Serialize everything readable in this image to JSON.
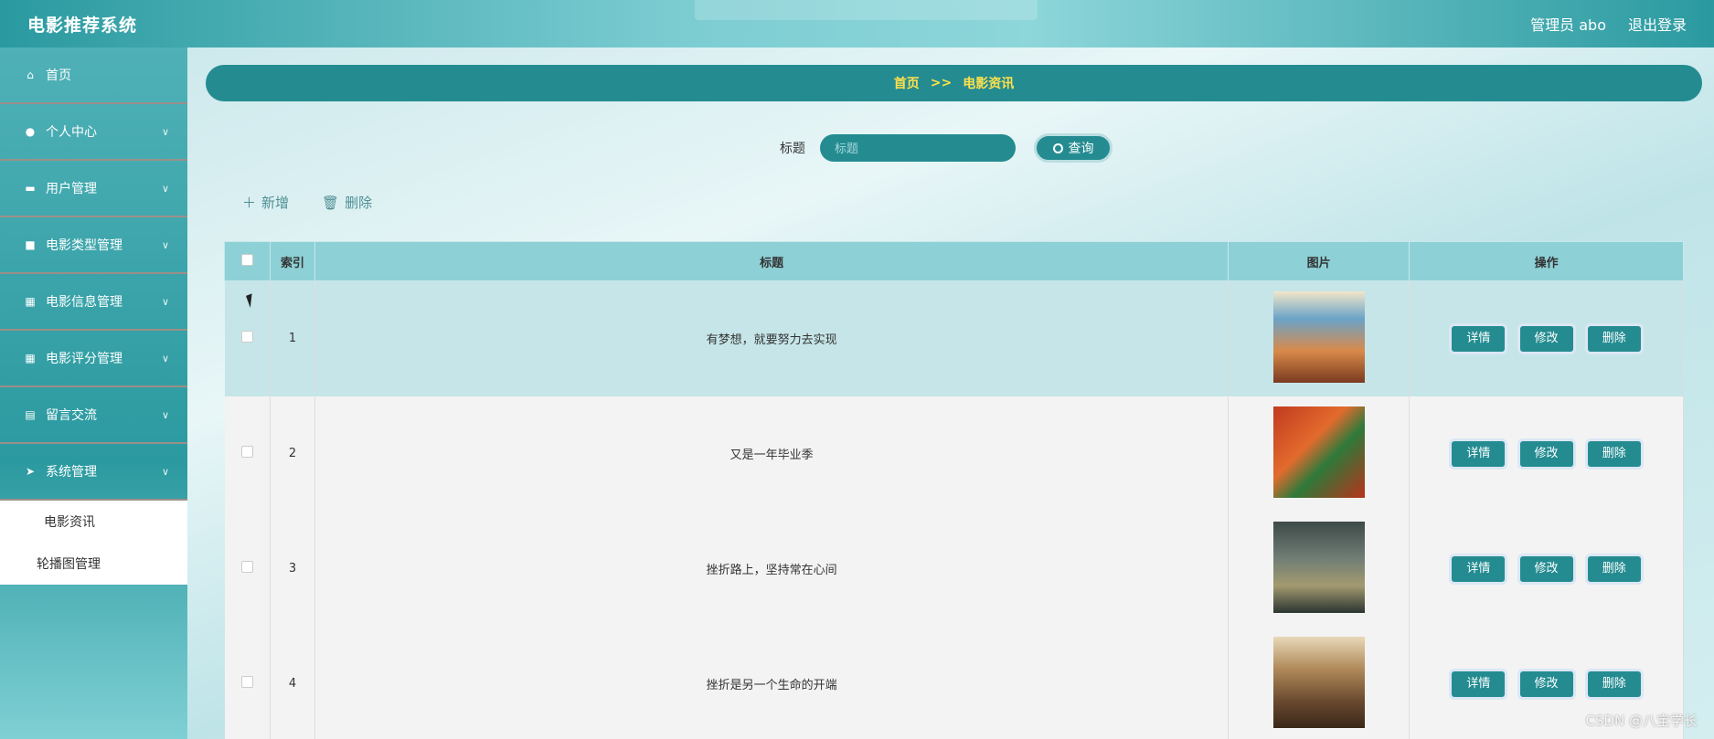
{
  "header": {
    "app_title": "电影推荐系统",
    "user_label": "管理员 abo",
    "logout_label": "退出登录"
  },
  "sidebar": {
    "items": [
      {
        "label": "首页",
        "icon": "home-icon",
        "has_chevron": false
      },
      {
        "label": "个人中心",
        "icon": "user-icon",
        "has_chevron": true
      },
      {
        "label": "用户管理",
        "icon": "monitor-icon",
        "has_chevron": true
      },
      {
        "label": "电影类型管理",
        "icon": "chat-icon",
        "has_chevron": true
      },
      {
        "label": "电影信息管理",
        "icon": "grid-icon",
        "has_chevron": true
      },
      {
        "label": "电影评分管理",
        "icon": "grid-icon",
        "has_chevron": true
      },
      {
        "label": "留言交流",
        "icon": "clipboard-icon",
        "has_chevron": true
      },
      {
        "label": "系统管理",
        "icon": "send-icon",
        "has_chevron": true
      }
    ],
    "submenu": [
      {
        "label": "电影资讯"
      },
      {
        "label": "轮播图管理"
      }
    ]
  },
  "breadcrumb": {
    "home": "首页",
    "separator": ">>",
    "current": "电影资讯"
  },
  "search": {
    "label": "标题",
    "placeholder": "标题",
    "button_label": "查询"
  },
  "actions": {
    "add_label": "新增",
    "delete_label": "删除"
  },
  "table": {
    "headers": {
      "index": "索引",
      "title": "标题",
      "image": "图片",
      "operations": "操作"
    },
    "rows": [
      {
        "index": "1",
        "title": "有梦想，就要努力去实现",
        "highlight": true
      },
      {
        "index": "2",
        "title": "又是一年毕业季",
        "highlight": false
      },
      {
        "index": "3",
        "title": "挫折路上，坚持常在心间",
        "highlight": false
      },
      {
        "index": "4",
        "title": "挫折是另一个生命的开端",
        "highlight": false
      }
    ],
    "row_buttons": {
      "detail": "详情",
      "edit": "修改",
      "delete": "删除"
    }
  },
  "watermark": "CSDN @八宝学长",
  "colors": {
    "accent": "#248c91",
    "breadcrumb_text": "#ffe04a",
    "header_row": "#8dd0d6"
  }
}
